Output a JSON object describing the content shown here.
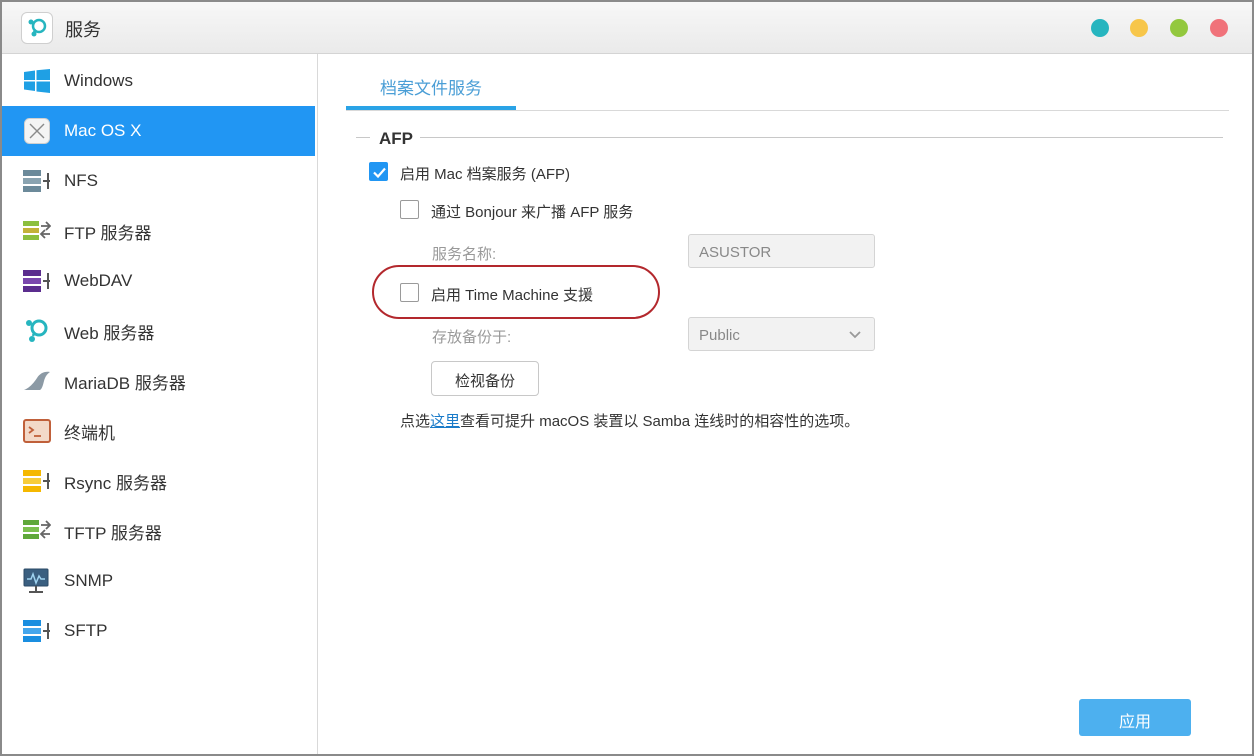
{
  "window": {
    "title": "服务",
    "controls": [
      {
        "name": "teal",
        "color": "#26b5bf"
      },
      {
        "name": "yellow",
        "color": "#f7c64a"
      },
      {
        "name": "green",
        "color": "#93c83e"
      },
      {
        "name": "red",
        "color": "#f0727a"
      }
    ]
  },
  "sidebar": {
    "items": [
      {
        "label": "Windows",
        "icon": "windows-icon"
      },
      {
        "label": "Mac OS X",
        "icon": "macos-icon",
        "active": true
      },
      {
        "label": "NFS",
        "icon": "nfs-icon"
      },
      {
        "label": "FTP 服务器",
        "icon": "ftp-icon"
      },
      {
        "label": "WebDAV",
        "icon": "webdav-icon"
      },
      {
        "label": "Web 服务器",
        "icon": "web-server-icon"
      },
      {
        "label": "MariaDB 服务器",
        "icon": "mariadb-icon"
      },
      {
        "label": "终端机",
        "icon": "terminal-icon"
      },
      {
        "label": "Rsync 服务器",
        "icon": "rsync-icon"
      },
      {
        "label": "TFTP 服务器",
        "icon": "tftp-icon"
      },
      {
        "label": "SNMP",
        "icon": "snmp-icon"
      },
      {
        "label": "SFTP",
        "icon": "sftp-icon"
      }
    ]
  },
  "main": {
    "tab": "档案文件服务",
    "section_title": "AFP",
    "enable_afp": {
      "label": "启用 Mac 档案服务 (AFP)",
      "checked": true
    },
    "bonjour": {
      "label": "通过 Bonjour 来广播 AFP 服务",
      "checked": false
    },
    "service_name": {
      "label": "服务名称:",
      "value": "ASUSTOR"
    },
    "time_machine": {
      "label": "启用 Time Machine 支援",
      "checked": false
    },
    "backup_location": {
      "label": "存放备份于:",
      "value": "Public"
    },
    "view_backup_button": "检视备份",
    "hint": {
      "prefix": "点选",
      "link": "这里",
      "suffix": "查看可提升 macOS 装置以 Samba 连线时的相容性的选项。"
    },
    "apply_button": "应用"
  },
  "colors": {
    "accent": "#2196f3",
    "highlight_ring": "#b3282d",
    "apply": "#4db0ef"
  }
}
